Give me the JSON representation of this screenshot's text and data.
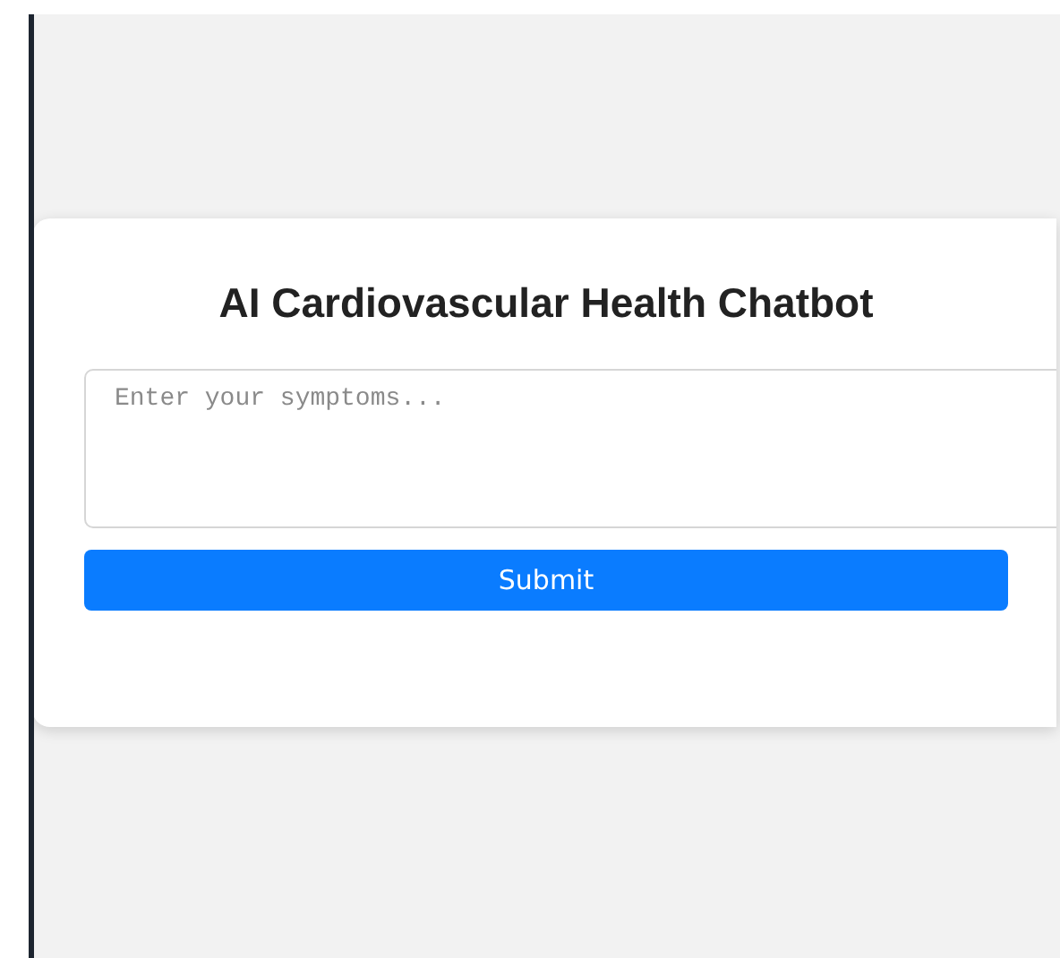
{
  "card": {
    "title": "AI Cardiovascular Health Chatbot",
    "symptoms_field": {
      "placeholder": "Enter your symptoms..."
    },
    "submit_button": "Submit"
  }
}
